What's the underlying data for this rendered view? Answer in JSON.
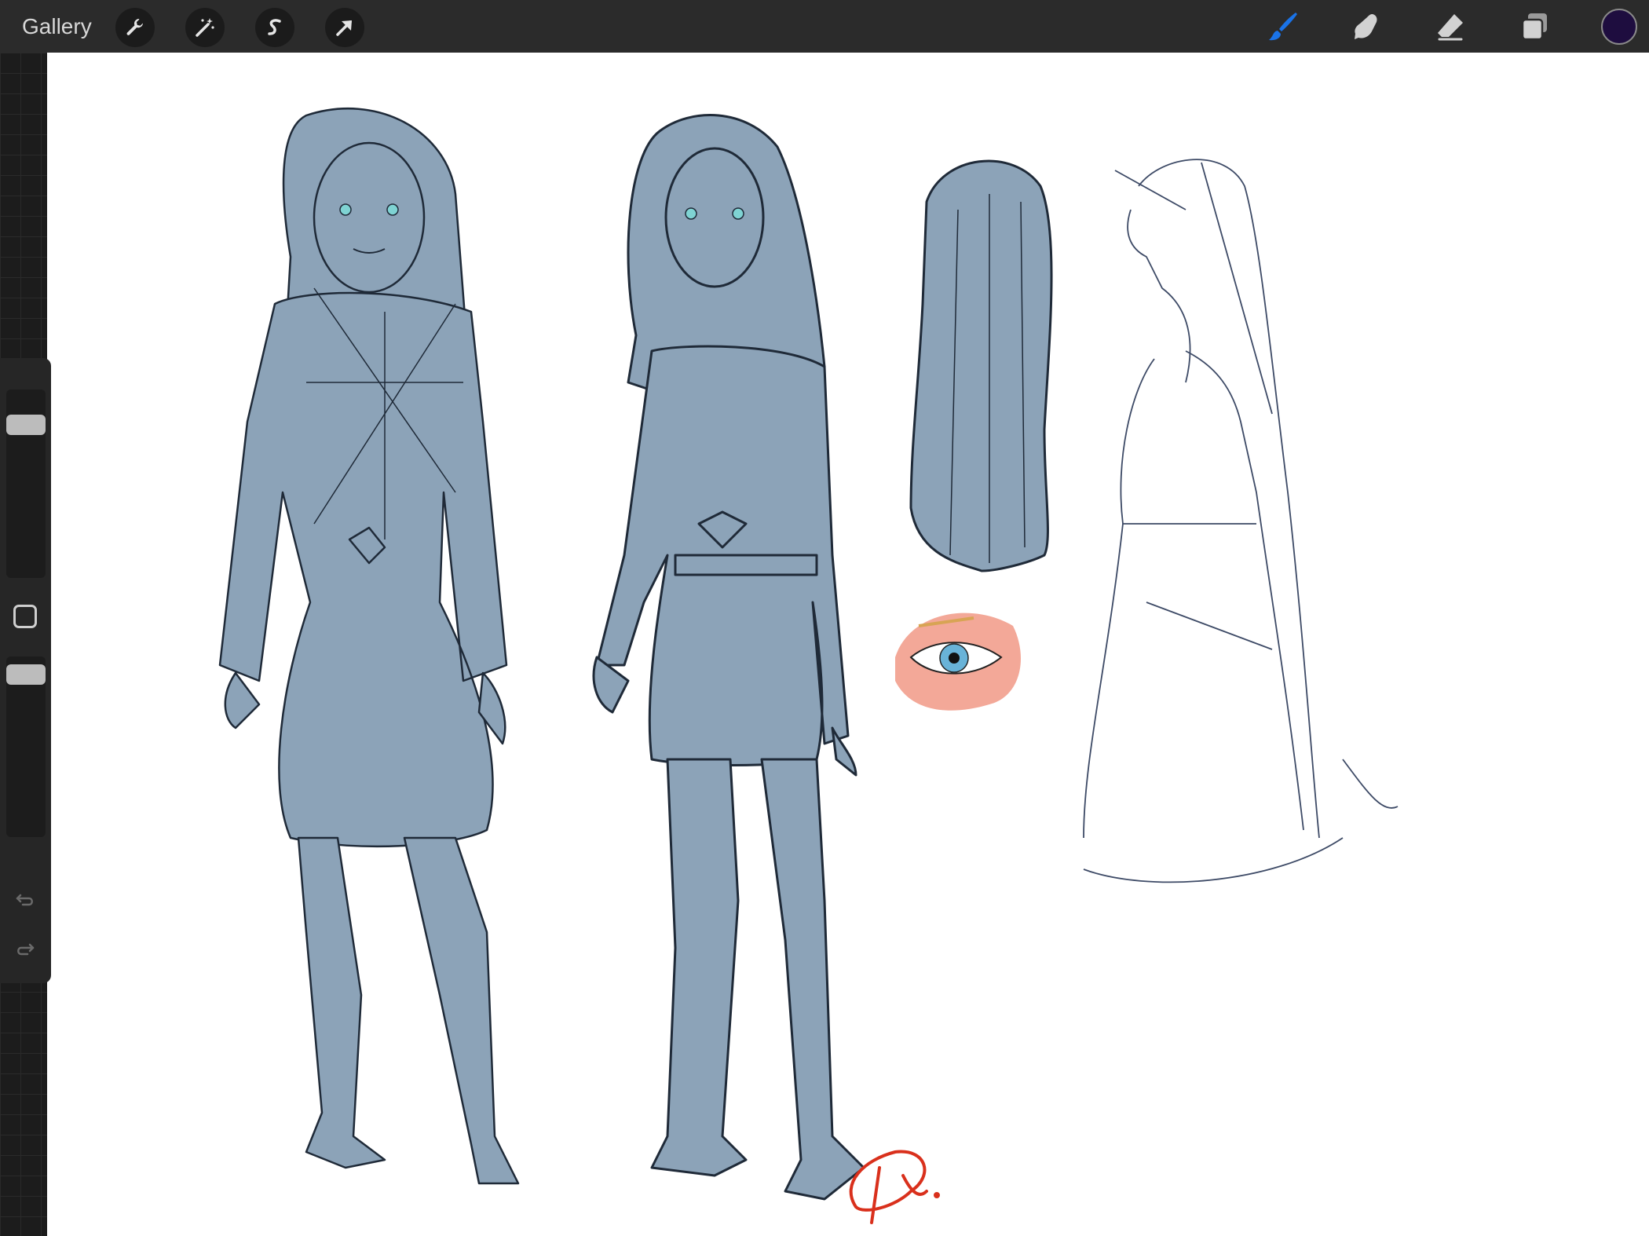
{
  "topbar": {
    "gallery_label": "Gallery",
    "left_tools": [
      {
        "name": "actions",
        "icon": "wrench-icon"
      },
      {
        "name": "adjustments",
        "icon": "magic-wand-icon"
      },
      {
        "name": "selection",
        "icon": "selection-s-icon"
      },
      {
        "name": "transform",
        "icon": "arrow-cursor-icon"
      }
    ],
    "right_tools": [
      {
        "name": "brush",
        "icon": "brush-icon",
        "active": true
      },
      {
        "name": "smudge",
        "icon": "smudge-finger-icon",
        "active": false
      },
      {
        "name": "eraser",
        "icon": "eraser-icon",
        "active": false
      },
      {
        "name": "layers",
        "icon": "layers-icon",
        "active": false
      }
    ],
    "current_color": "#1e0d3f",
    "active_tool_color": "#1a73e8"
  },
  "sidebar": {
    "brush_size_level": 0.15,
    "brush_opacity_level": 0.05,
    "modify_button_icon": "square-icon",
    "undo_icon": "undo-icon",
    "redo_icon": "redo-icon"
  },
  "canvas": {
    "background": "#ffffff",
    "figure_fill": "#8ca3b8",
    "line_color": "#1f2a38",
    "signature_color": "#d9301c",
    "signature_icon": "signature-mark-icon"
  }
}
